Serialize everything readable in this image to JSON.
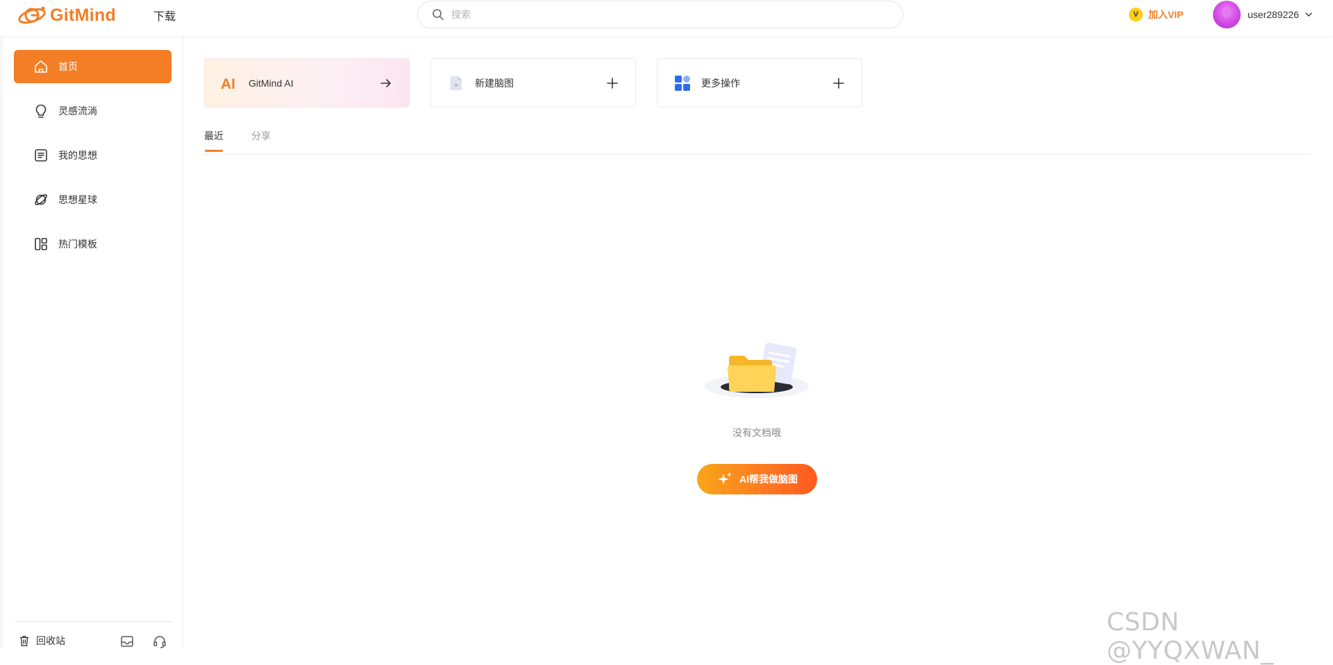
{
  "app": {
    "logo_text": "GitMind",
    "download_label": "下载",
    "brand_color": "#f37e25"
  },
  "search": {
    "placeholder": "搜索",
    "icon": "search-icon"
  },
  "header": {
    "vip_badge": "V",
    "vip_label": "加入VIP",
    "username": "user289226"
  },
  "sidebar": {
    "items": [
      {
        "label": "首页",
        "icon": "home-icon",
        "active": true
      },
      {
        "label": "灵感流淌",
        "icon": "lightbulb-icon",
        "active": false
      },
      {
        "label": "我的思想",
        "icon": "document-icon",
        "active": false
      },
      {
        "label": "思想星球",
        "icon": "planet-icon",
        "active": false
      },
      {
        "label": "热门模板",
        "icon": "template-icon",
        "active": false
      }
    ],
    "recycle_label": "回收站"
  },
  "cards": {
    "ai_label": "GitMind AI",
    "ai_icon_text": "AI",
    "newmap_label": "新建脑图",
    "more_label": "更多操作"
  },
  "tabs": {
    "recent": "最近",
    "shared": "分享"
  },
  "empty_state": {
    "text": "没有文档哦",
    "button_label": "AI帮我做脑图"
  },
  "watermark": "CSDN @YYQXWAN_"
}
